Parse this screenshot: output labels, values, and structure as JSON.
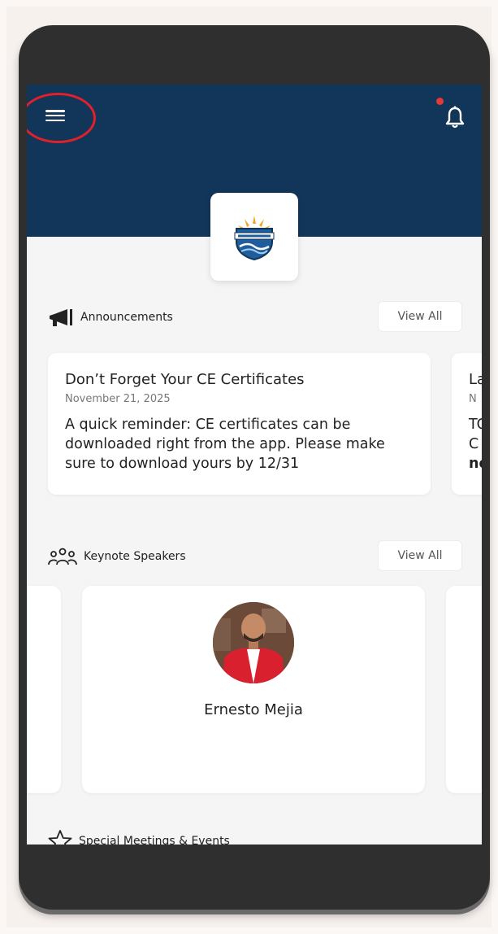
{
  "header": {
    "menu_icon": "hamburger-menu-icon",
    "notification_icon": "bell-icon",
    "notification_dot_color": "#e53935",
    "background_color": "#12355a",
    "highlight_color": "#e0202a"
  },
  "announcements": {
    "title": "Announcements",
    "view_all_label": "View All",
    "icon": "megaphone-icon",
    "cards": [
      {
        "title": "Don’t Forget Your CE Certificates",
        "date": "November 21, 2025",
        "body": "A quick reminder: CE certificates can be downloaded right from the app. Please make sure to download yours by 12/31"
      },
      {
        "title": "La",
        "date": "N",
        "body_line1": "TC",
        "body_line2": "C",
        "body_line3": "no"
      }
    ]
  },
  "keynote": {
    "title": "Keynote Speakers",
    "view_all_label": "View All",
    "icon": "people-group-icon",
    "speakers": [
      {
        "name": "Ernesto Mejia"
      }
    ]
  },
  "special": {
    "title": "Special Meetings & Events",
    "icon": "star-outline-icon"
  }
}
